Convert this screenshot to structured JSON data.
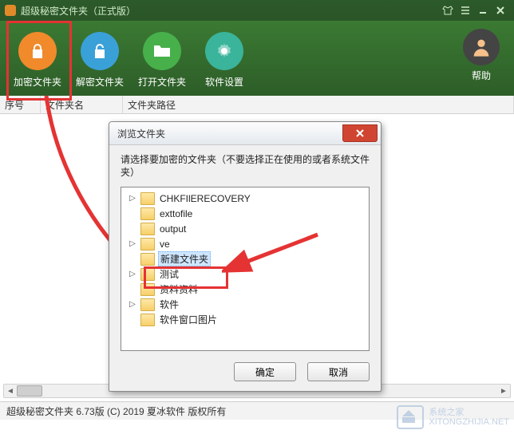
{
  "title": "超级秘密文件夹（正式版）",
  "toolbar": {
    "encrypt": "加密文件夹",
    "decrypt": "解密文件夹",
    "open": "打开文件夹",
    "settings": "软件设置",
    "help": "帮助"
  },
  "columns": {
    "seq": "序号",
    "name": "文件夹名",
    "path": "文件夹路径"
  },
  "status": "超级秘密文件夹 6.73版 (C) 2019 夏冰软件 版权所有",
  "dialog": {
    "title": "浏览文件夹",
    "instruction": "请选择要加密的文件夹（不要选择正在使用的或者系统文件夹）",
    "ok": "确定",
    "cancel": "取消",
    "folders": [
      {
        "name": "CHKFIlERECOVERY",
        "expandable": true,
        "selected": false
      },
      {
        "name": "exttofile",
        "expandable": false,
        "selected": false
      },
      {
        "name": "output",
        "expandable": false,
        "selected": false
      },
      {
        "name": "ve",
        "expandable": true,
        "selected": false
      },
      {
        "name": "新建文件夹",
        "expandable": false,
        "selected": true
      },
      {
        "name": "测试",
        "expandable": true,
        "selected": false
      },
      {
        "name": "资料资料",
        "expandable": false,
        "selected": false
      },
      {
        "name": "软件",
        "expandable": true,
        "selected": false
      },
      {
        "name": "软件窗口图片",
        "expandable": false,
        "selected": false
      }
    ]
  },
  "watermark": {
    "line1": "系统之家",
    "line2": "XITONGZHIJIA.NET"
  }
}
